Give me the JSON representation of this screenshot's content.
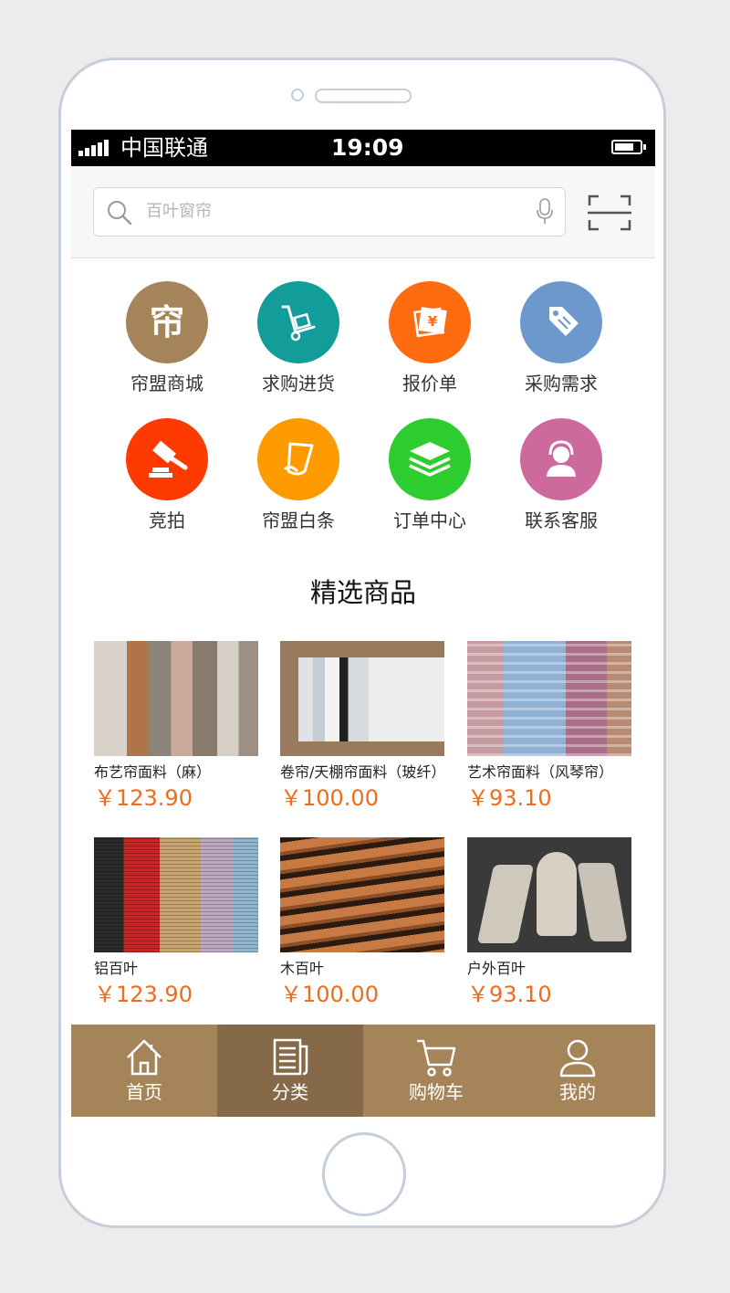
{
  "status_bar": {
    "carrier": "中国联通",
    "time": "19:09"
  },
  "search": {
    "placeholder": "百叶窗帘"
  },
  "categories": [
    {
      "label": "帘盟商城",
      "color": "#a5845a",
      "icon": "shop-logo-icon",
      "glyph": "帘"
    },
    {
      "label": "求购进货",
      "color": "#139d9a",
      "icon": "hand-truck-icon"
    },
    {
      "label": "报价单",
      "color": "#ff6b10",
      "icon": "price-photo-icon"
    },
    {
      "label": "采购需求",
      "color": "#6c98cc",
      "icon": "price-tag-icon"
    },
    {
      "label": "竞拍",
      "color": "#ff3a00",
      "icon": "auction-gavel-icon"
    },
    {
      "label": "帘盟白条",
      "color": "#ff9a00",
      "icon": "ticket-icon"
    },
    {
      "label": "订单中心",
      "color": "#2ecc2e",
      "icon": "stack-icon"
    },
    {
      "label": "联系客服",
      "color": "#cc6a9e",
      "icon": "customer-service-icon"
    }
  ],
  "section_title": "精选商品",
  "products": [
    {
      "name": "布艺帘面料（麻）",
      "price": "￥123.90"
    },
    {
      "name": "卷帘/天棚帘面料（玻纤）",
      "price": "￥100.00"
    },
    {
      "name": "艺术帘面料（风琴帘）",
      "price": "￥93.10"
    },
    {
      "name": "铝百叶",
      "price": "￥123.90"
    },
    {
      "name": "木百叶",
      "price": "￥100.00"
    },
    {
      "name": "户外百叶",
      "price": "￥93.10"
    }
  ],
  "tabs": [
    {
      "label": "首页",
      "icon": "home-icon",
      "active": false
    },
    {
      "label": "分类",
      "icon": "category-icon",
      "active": true
    },
    {
      "label": "购物车",
      "icon": "cart-icon",
      "active": false
    },
    {
      "label": "我的",
      "icon": "user-icon",
      "active": false
    }
  ],
  "colors": {
    "brand": "#a5845a",
    "brand_dark": "#856949",
    "price": "#f26a1b"
  }
}
